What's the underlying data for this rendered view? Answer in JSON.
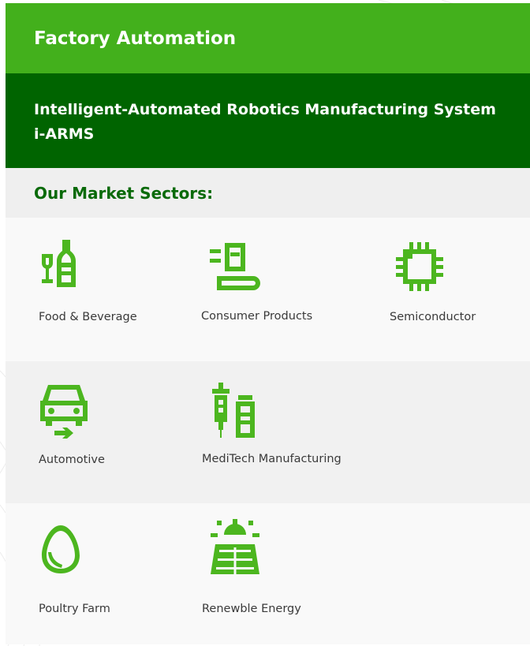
{
  "colors": {
    "header_bg": "#43b01c",
    "subheader_bg": "#006400",
    "sectors_title_bg": "#efefef",
    "sectors_title_text": "#0a6a0a",
    "row_light_bg": "#f9f9f9",
    "row_gray_bg": "#f1f1f1",
    "icon_green": "#4cb61f"
  },
  "header": {
    "title": "Factory Automation"
  },
  "subheader": {
    "title": "Intelligent-Automated Robotics Manufacturing System i-ARMS"
  },
  "sectors": {
    "title": "Our Market Sectors:",
    "items": [
      {
        "label": "Food & Beverage",
        "icon": "wine-bottle-glass-icon"
      },
      {
        "label": "Consumer Products",
        "icon": "conveyor-product-icon"
      },
      {
        "label": "Semiconductor",
        "icon": "chip-icon"
      },
      {
        "label": "Automotive",
        "icon": "car-charging-icon"
      },
      {
        "label": "MediTech Manufacturing",
        "icon": "syringe-vial-icon"
      },
      {
        "label": "Poultry Farm",
        "icon": "egg-icon"
      },
      {
        "label": "Renewble Energy",
        "icon": "solar-panel-icon"
      }
    ]
  }
}
